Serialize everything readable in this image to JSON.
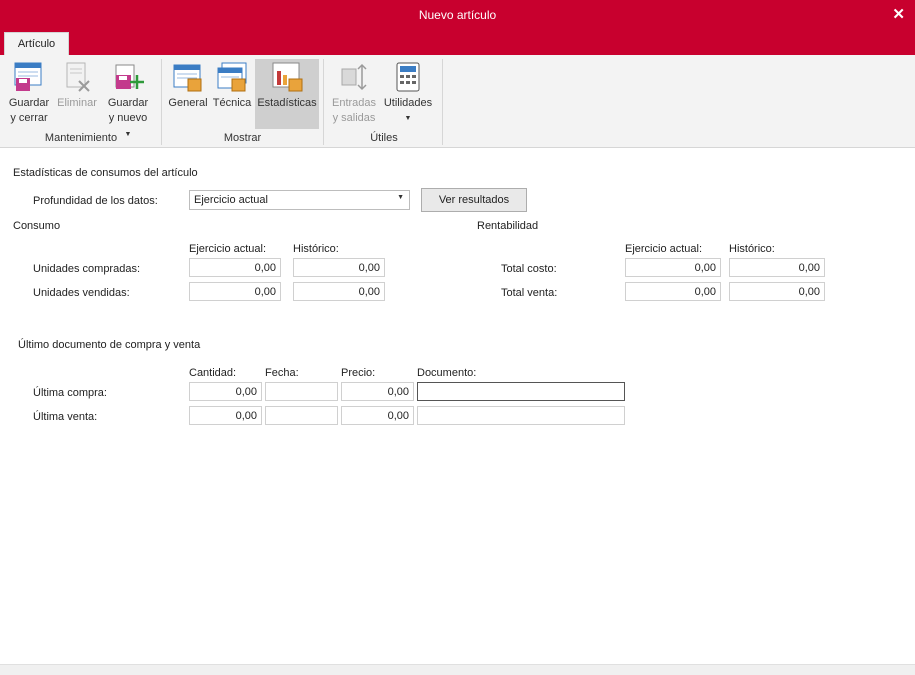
{
  "window": {
    "title": "Nuevo artículo",
    "close_label": "✕"
  },
  "tabs": [
    {
      "label": "Artículo"
    }
  ],
  "ribbon": {
    "mantenimiento": {
      "label": "Mantenimiento",
      "buttons": [
        {
          "line1": "Guardar",
          "line2": "y cerrar",
          "icon": "save-close-icon",
          "enabled": true
        },
        {
          "line1": "Eliminar",
          "line2": "",
          "icon": "delete-icon",
          "enabled": false
        },
        {
          "line1": "Guardar",
          "line2": "y nuevo",
          "icon": "save-new-icon",
          "enabled": true
        }
      ]
    },
    "mostrar": {
      "label": "Mostrar",
      "buttons": [
        {
          "line1": "General",
          "icon": "general-icon"
        },
        {
          "line1": "Técnica",
          "icon": "tecnica-icon"
        },
        {
          "line1": "Estadísticas",
          "icon": "estadisticas-icon",
          "active": true
        }
      ]
    },
    "utiles": {
      "label": "Útiles",
      "buttons": [
        {
          "line1": "Entradas",
          "line2": "y salidas",
          "icon": "entradas-salidas-icon",
          "enabled": false
        },
        {
          "line1": "Utilidades",
          "icon": "calculator-icon",
          "enabled": true
        }
      ]
    }
  },
  "stats": {
    "heading": "Estadísticas de consumos del artículo",
    "depth_label": "Profundidad de los datos:",
    "depth_value": "Ejercicio actual",
    "results_button": "Ver resultados"
  },
  "consumo": {
    "heading": "Consumo",
    "col_current": "Ejercicio actual:",
    "col_history": "Histórico:",
    "rows": [
      {
        "label": "Unidades compradas:",
        "current": "0,00",
        "history": "0,00"
      },
      {
        "label": "Unidades vendidas:",
        "current": "0,00",
        "history": "0,00"
      }
    ]
  },
  "rentabilidad": {
    "heading": "Rentabilidad",
    "col_current": "Ejercicio actual:",
    "col_history": "Histórico:",
    "rows": [
      {
        "label": "Total costo:",
        "current": "0,00",
        "history": "0,00"
      },
      {
        "label": "Total venta:",
        "current": "0,00",
        "history": "0,00"
      }
    ]
  },
  "ultimo": {
    "heading": "Último documento de compra y venta",
    "col_cantidad": "Cantidad:",
    "col_fecha": "Fecha:",
    "col_precio": "Precio:",
    "col_documento": "Documento:",
    "rows": [
      {
        "label": "Última compra:",
        "cantidad": "0,00",
        "fecha": "",
        "precio": "0,00",
        "documento": ""
      },
      {
        "label": "Última venta:",
        "cantidad": "0,00",
        "fecha": "",
        "precio": "0,00",
        "documento": ""
      }
    ]
  }
}
